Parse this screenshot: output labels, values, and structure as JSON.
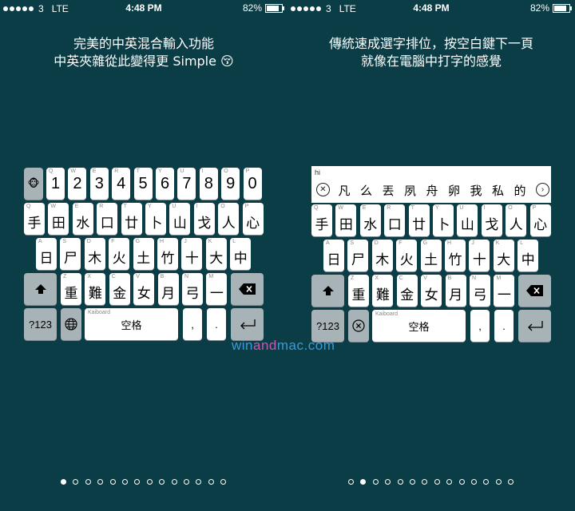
{
  "status": {
    "carrier": "3",
    "network": "LTE",
    "time": "4:48 PM",
    "battery": "82%",
    "battery_level": 0.82
  },
  "screens": [
    {
      "caption": [
        "完美的中英混合輸入功能",
        "中英夾雜從此變得更 Simple 😚"
      ],
      "active_dot": 0
    },
    {
      "caption": [
        "傳統速成選字排位，按空白鍵下一頁",
        "就像在電腦中打字的感覺"
      ],
      "active_dot": 1
    }
  ],
  "keyboard": {
    "numbers": [
      "1",
      "2",
      "3",
      "4",
      "5",
      "6",
      "7",
      "8",
      "9",
      "0"
    ],
    "number_letters": [
      "Q",
      "W",
      "E",
      "R",
      "T",
      "Y",
      "U",
      "I",
      "O",
      "P"
    ],
    "row1": [
      {
        "l": "Q",
        "h": "手"
      },
      {
        "l": "W",
        "h": "田"
      },
      {
        "l": "E",
        "h": "水"
      },
      {
        "l": "R",
        "h": "口"
      },
      {
        "l": "T",
        "h": "廿"
      },
      {
        "l": "Y",
        "h": "卜"
      },
      {
        "l": "U",
        "h": "山"
      },
      {
        "l": "I",
        "h": "戈"
      },
      {
        "l": "O",
        "h": "人"
      },
      {
        "l": "P",
        "h": "心"
      }
    ],
    "row2": [
      {
        "l": "A",
        "h": "日"
      },
      {
        "l": "S",
        "h": "尸"
      },
      {
        "l": "D",
        "h": "木"
      },
      {
        "l": "F",
        "h": "火"
      },
      {
        "l": "G",
        "h": "土"
      },
      {
        "l": "H",
        "h": "竹"
      },
      {
        "l": "J",
        "h": "十"
      },
      {
        "l": "K",
        "h": "大"
      },
      {
        "l": "L",
        "h": "中"
      }
    ],
    "row3": [
      {
        "l": "Z",
        "h": "重"
      },
      {
        "l": "X",
        "h": "難"
      },
      {
        "l": "C",
        "h": "金"
      },
      {
        "l": "V",
        "h": "女"
      },
      {
        "l": "B",
        "h": "月"
      },
      {
        "l": "N",
        "h": "弓"
      },
      {
        "l": "M",
        "h": "一"
      }
    ],
    "mode_label": "?123",
    "space_label": "空格",
    "space_brand": "Kaiboard",
    "comma": ",",
    "period": ".",
    "emoji_key": "🐵"
  },
  "candidates": {
    "input": "hi",
    "items": [
      "凡",
      "么",
      "丟",
      "夙",
      "舟",
      "卵",
      "我",
      "私",
      "的"
    ]
  },
  "icons": {
    "shift": "shift-arrow-icon",
    "delete": "backspace-icon",
    "globe": "globe-icon",
    "return": "return-icon",
    "clear": "close-circle-icon",
    "next": "chevron-right-icon"
  },
  "watermark": {
    "a": "win",
    "b": "and",
    "c": "mac",
    "d": ".com"
  },
  "page_dots_count": 14
}
